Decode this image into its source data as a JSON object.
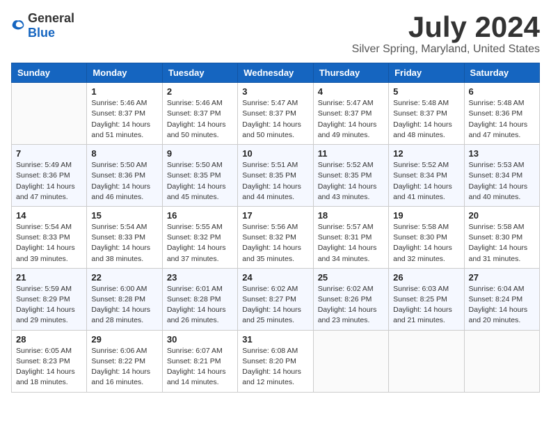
{
  "logo": {
    "general": "General",
    "blue": "Blue"
  },
  "title": "July 2024",
  "location": "Silver Spring, Maryland, United States",
  "weekdays": [
    "Sunday",
    "Monday",
    "Tuesday",
    "Wednesday",
    "Thursday",
    "Friday",
    "Saturday"
  ],
  "weeks": [
    [
      {
        "day": "",
        "info": ""
      },
      {
        "day": "1",
        "info": "Sunrise: 5:46 AM\nSunset: 8:37 PM\nDaylight: 14 hours\nand 51 minutes."
      },
      {
        "day": "2",
        "info": "Sunrise: 5:46 AM\nSunset: 8:37 PM\nDaylight: 14 hours\nand 50 minutes."
      },
      {
        "day": "3",
        "info": "Sunrise: 5:47 AM\nSunset: 8:37 PM\nDaylight: 14 hours\nand 50 minutes."
      },
      {
        "day": "4",
        "info": "Sunrise: 5:47 AM\nSunset: 8:37 PM\nDaylight: 14 hours\nand 49 minutes."
      },
      {
        "day": "5",
        "info": "Sunrise: 5:48 AM\nSunset: 8:37 PM\nDaylight: 14 hours\nand 48 minutes."
      },
      {
        "day": "6",
        "info": "Sunrise: 5:48 AM\nSunset: 8:36 PM\nDaylight: 14 hours\nand 47 minutes."
      }
    ],
    [
      {
        "day": "7",
        "info": "Sunrise: 5:49 AM\nSunset: 8:36 PM\nDaylight: 14 hours\nand 47 minutes."
      },
      {
        "day": "8",
        "info": "Sunrise: 5:50 AM\nSunset: 8:36 PM\nDaylight: 14 hours\nand 46 minutes."
      },
      {
        "day": "9",
        "info": "Sunrise: 5:50 AM\nSunset: 8:35 PM\nDaylight: 14 hours\nand 45 minutes."
      },
      {
        "day": "10",
        "info": "Sunrise: 5:51 AM\nSunset: 8:35 PM\nDaylight: 14 hours\nand 44 minutes."
      },
      {
        "day": "11",
        "info": "Sunrise: 5:52 AM\nSunset: 8:35 PM\nDaylight: 14 hours\nand 43 minutes."
      },
      {
        "day": "12",
        "info": "Sunrise: 5:52 AM\nSunset: 8:34 PM\nDaylight: 14 hours\nand 41 minutes."
      },
      {
        "day": "13",
        "info": "Sunrise: 5:53 AM\nSunset: 8:34 PM\nDaylight: 14 hours\nand 40 minutes."
      }
    ],
    [
      {
        "day": "14",
        "info": "Sunrise: 5:54 AM\nSunset: 8:33 PM\nDaylight: 14 hours\nand 39 minutes."
      },
      {
        "day": "15",
        "info": "Sunrise: 5:54 AM\nSunset: 8:33 PM\nDaylight: 14 hours\nand 38 minutes."
      },
      {
        "day": "16",
        "info": "Sunrise: 5:55 AM\nSunset: 8:32 PM\nDaylight: 14 hours\nand 37 minutes."
      },
      {
        "day": "17",
        "info": "Sunrise: 5:56 AM\nSunset: 8:32 PM\nDaylight: 14 hours\nand 35 minutes."
      },
      {
        "day": "18",
        "info": "Sunrise: 5:57 AM\nSunset: 8:31 PM\nDaylight: 14 hours\nand 34 minutes."
      },
      {
        "day": "19",
        "info": "Sunrise: 5:58 AM\nSunset: 8:30 PM\nDaylight: 14 hours\nand 32 minutes."
      },
      {
        "day": "20",
        "info": "Sunrise: 5:58 AM\nSunset: 8:30 PM\nDaylight: 14 hours\nand 31 minutes."
      }
    ],
    [
      {
        "day": "21",
        "info": "Sunrise: 5:59 AM\nSunset: 8:29 PM\nDaylight: 14 hours\nand 29 minutes."
      },
      {
        "day": "22",
        "info": "Sunrise: 6:00 AM\nSunset: 8:28 PM\nDaylight: 14 hours\nand 28 minutes."
      },
      {
        "day": "23",
        "info": "Sunrise: 6:01 AM\nSunset: 8:28 PM\nDaylight: 14 hours\nand 26 minutes."
      },
      {
        "day": "24",
        "info": "Sunrise: 6:02 AM\nSunset: 8:27 PM\nDaylight: 14 hours\nand 25 minutes."
      },
      {
        "day": "25",
        "info": "Sunrise: 6:02 AM\nSunset: 8:26 PM\nDaylight: 14 hours\nand 23 minutes."
      },
      {
        "day": "26",
        "info": "Sunrise: 6:03 AM\nSunset: 8:25 PM\nDaylight: 14 hours\nand 21 minutes."
      },
      {
        "day": "27",
        "info": "Sunrise: 6:04 AM\nSunset: 8:24 PM\nDaylight: 14 hours\nand 20 minutes."
      }
    ],
    [
      {
        "day": "28",
        "info": "Sunrise: 6:05 AM\nSunset: 8:23 PM\nDaylight: 14 hours\nand 18 minutes."
      },
      {
        "day": "29",
        "info": "Sunrise: 6:06 AM\nSunset: 8:22 PM\nDaylight: 14 hours\nand 16 minutes."
      },
      {
        "day": "30",
        "info": "Sunrise: 6:07 AM\nSunset: 8:21 PM\nDaylight: 14 hours\nand 14 minutes."
      },
      {
        "day": "31",
        "info": "Sunrise: 6:08 AM\nSunset: 8:20 PM\nDaylight: 14 hours\nand 12 minutes."
      },
      {
        "day": "",
        "info": ""
      },
      {
        "day": "",
        "info": ""
      },
      {
        "day": "",
        "info": ""
      }
    ]
  ]
}
